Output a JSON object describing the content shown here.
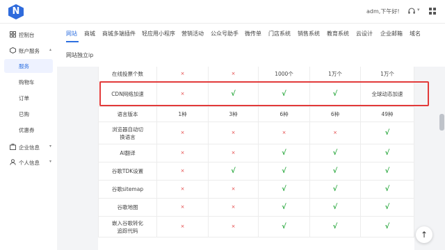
{
  "header": {
    "logo_letter": "N",
    "greeting": "adm,下午好!",
    "bell_icon": "headset-icon",
    "caret": "▾",
    "grid_icon": "grid-icon"
  },
  "sidebar": {
    "items": [
      {
        "label": "控制台",
        "icon": "dashboard-icon"
      },
      {
        "label": "账户服务",
        "icon": "account-icon",
        "caret": "▴"
      },
      {
        "label": "企业信息",
        "icon": "enterprise-icon",
        "caret": "▾"
      },
      {
        "label": "个人信息",
        "icon": "person-icon",
        "caret": "▾"
      }
    ],
    "sub_items": [
      {
        "label": "服务",
        "active": true
      },
      {
        "label": "购物车"
      },
      {
        "label": "订单"
      },
      {
        "label": "已购"
      },
      {
        "label": "优惠券"
      }
    ]
  },
  "tabs": [
    "网站",
    "商城",
    "商城多端插件",
    "轻应用小程序",
    "营销活动",
    "公众号助手",
    "微传单",
    "门店系统",
    "销售系统",
    "教育系统",
    "云设计",
    "企业邮箱",
    "域名",
    "网站独立ip"
  ],
  "table": {
    "rows": [
      {
        "feature": "在线投票个数",
        "values": [
          "×",
          "×",
          "1000个",
          "1万个",
          "1万个"
        ]
      },
      {
        "feature": "CDN网络加速",
        "values": [
          "×",
          "√",
          "√",
          "√",
          "全球动态加速"
        ]
      },
      {
        "feature": "语言版本",
        "values": [
          "1种",
          "3种",
          "6种",
          "6种",
          "49种"
        ]
      },
      {
        "feature": "浏览器自动切换语言",
        "values": [
          "×",
          "×",
          "×",
          "×",
          "√"
        ]
      },
      {
        "feature": "AI翻译",
        "values": [
          "×",
          "×",
          "√",
          "√",
          "√"
        ]
      },
      {
        "feature": "谷歌TDK设置",
        "values": [
          "×",
          "√",
          "√",
          "√",
          "√"
        ]
      },
      {
        "feature": "谷歌sitemap",
        "values": [
          "×",
          "×",
          "√",
          "√",
          "√"
        ]
      },
      {
        "feature": "谷歌地图",
        "values": [
          "×",
          "×",
          "√",
          "√",
          "√"
        ]
      },
      {
        "feature": "嵌入谷歌转化追踪代码",
        "values": [
          "×",
          "×",
          "√",
          "√",
          "√"
        ]
      }
    ]
  },
  "back_to_top": "↑",
  "colors": {
    "accent": "#2d6fe0",
    "cross": "#e23c3c",
    "check": "#2eaa42",
    "highlight": "#e23939"
  }
}
